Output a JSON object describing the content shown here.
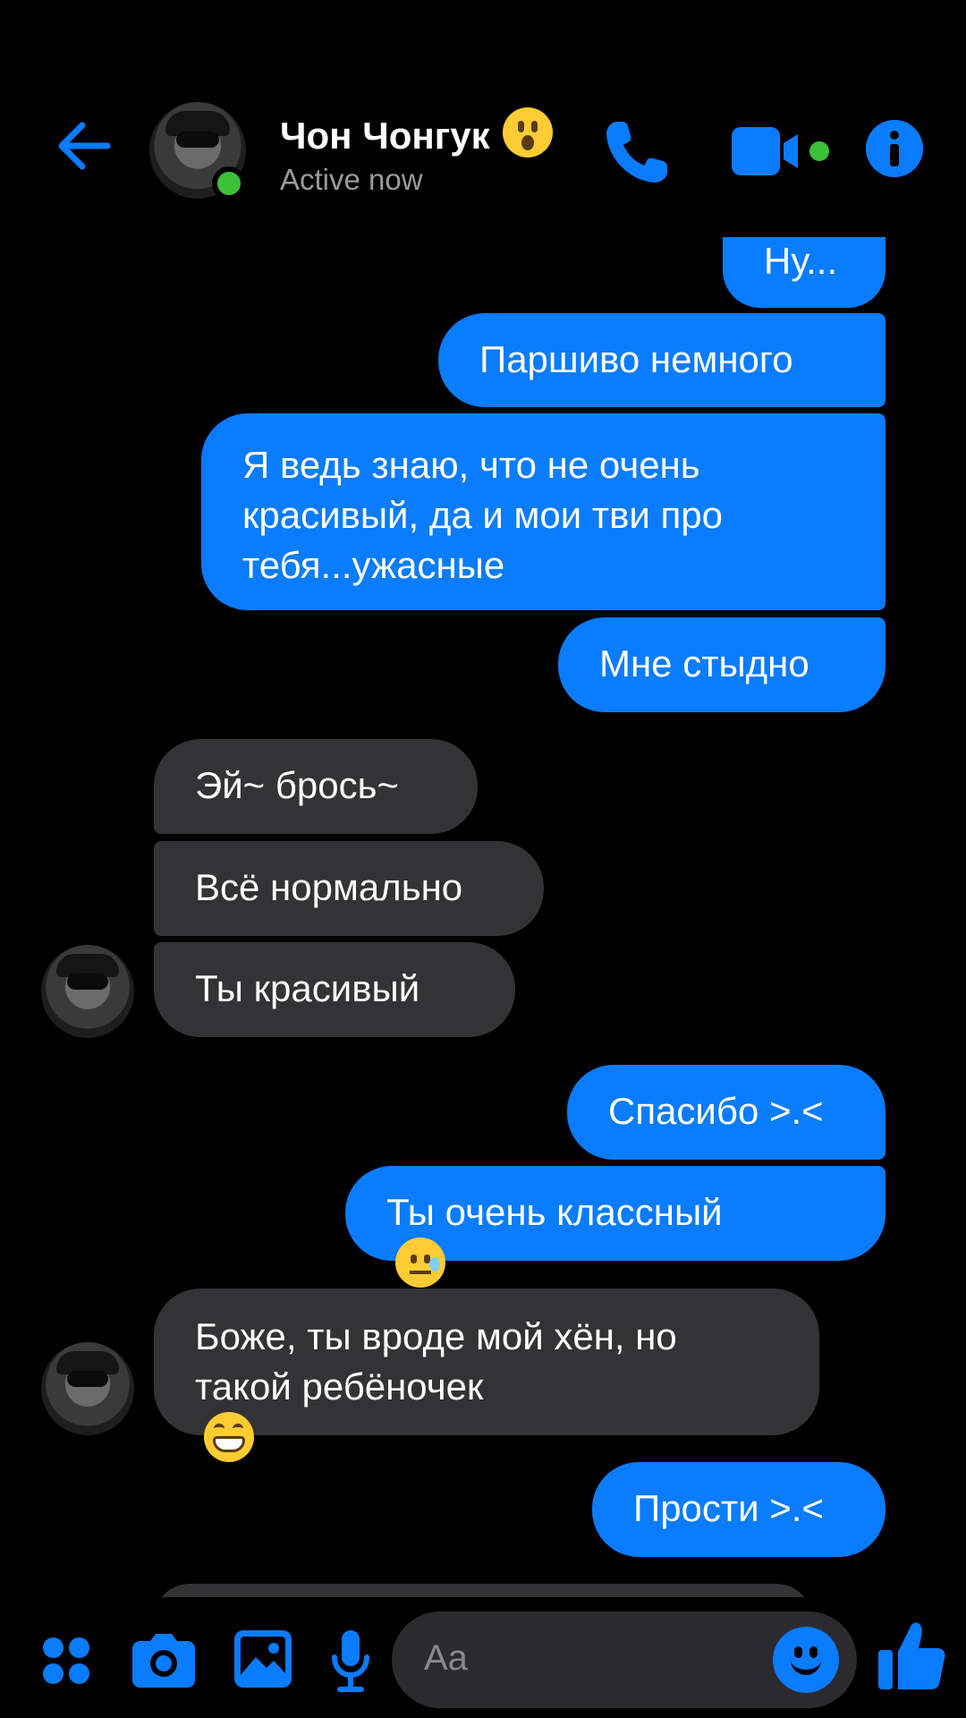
{
  "header": {
    "contact_name": "Чон Чонгук",
    "status": "Active now",
    "name_emoji": "hushed-face-icon"
  },
  "colors": {
    "accent": "#0a7cff",
    "incoming_bubble": "#333335",
    "online": "#3cc13b",
    "background": "#000000"
  },
  "messages": [
    {
      "dir": "out",
      "lines": [
        "Ну..."
      ]
    },
    {
      "dir": "out",
      "lines": [
        "Паршиво немного"
      ]
    },
    {
      "dir": "out",
      "lines": [
        "Я ведь знаю, что не очень",
        "красивый, да и мои тви про",
        "тебя...ужасные"
      ]
    },
    {
      "dir": "out",
      "lines": [
        "Мне стыдно"
      ]
    },
    {
      "dir": "in",
      "lines": [
        "Эй~ брось~"
      ]
    },
    {
      "dir": "in",
      "lines": [
        "Всё нормально"
      ]
    },
    {
      "dir": "in",
      "lines": [
        "Ты красивый"
      ]
    },
    {
      "dir": "out",
      "lines": [
        "Спасибо >.<"
      ]
    },
    {
      "dir": "out",
      "lines": [
        "Ты очень классный"
      ],
      "emoji": "sweat-smile-icon"
    },
    {
      "dir": "in",
      "lines": [
        "Боже, ты вроде мой хён, но",
        "такой ребёночек"
      ],
      "emoji": "grin-icon"
    },
    {
      "dir": "out",
      "lines": [
        "Прости >.<"
      ]
    }
  ],
  "composer": {
    "placeholder": "Aa"
  }
}
